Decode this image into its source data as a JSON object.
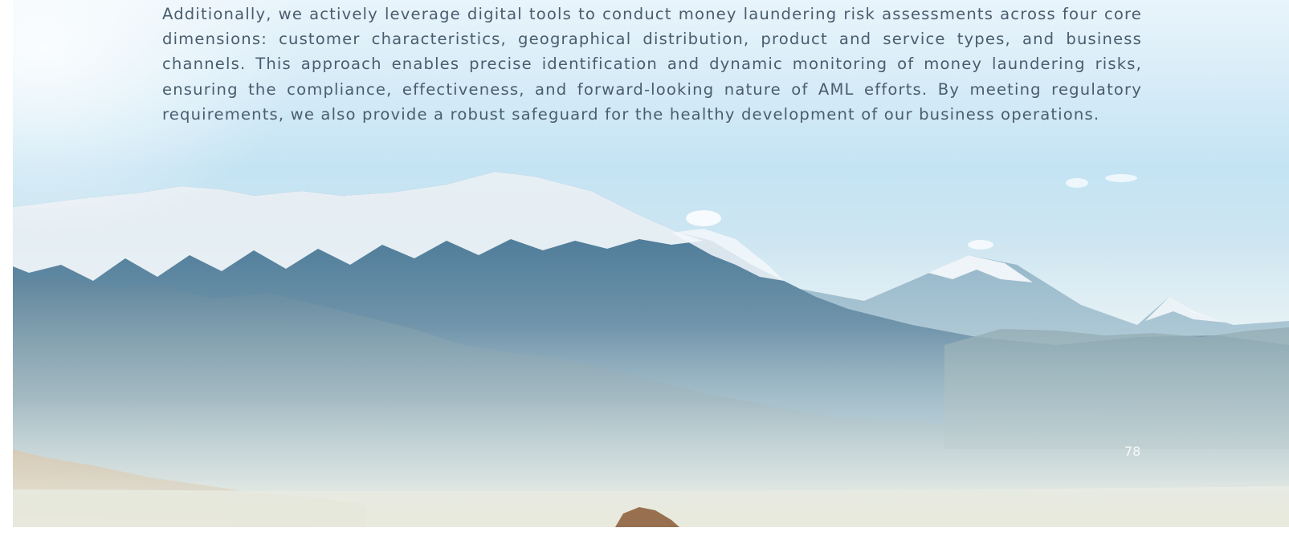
{
  "body": {
    "paragraph": "Additionally, we actively leverage digital tools to conduct money laundering risk assessments across four core dimensions: customer characteristics, geographical distribution, product and service types, and business channels. This approach enables precise identification and dynamic monitoring of money laundering risks, ensuring the compliance, effectiveness, and forward-looking nature of AML efforts. By meeting regulatory requirements, we also provide a robust safeguard for the healthy development of our business operations."
  },
  "footer": {
    "page_number": "78"
  },
  "colors": {
    "text": "#4a5d6e",
    "sky": "#c4e3f3",
    "mountain": "#3f6d8a",
    "snow": "#f2f7fb"
  },
  "background": {
    "image_subject": "mountain-landscape"
  }
}
